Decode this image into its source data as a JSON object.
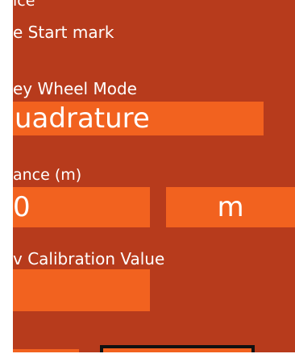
{
  "top_cut_text": "ice",
  "start_mark_text": "e Start mark",
  "wheel_mode_label": "ey Wheel Mode",
  "wheel_mode_value": "uadrature",
  "distance_label": "ance (m)",
  "distance_value": "0",
  "distance_unit": "m",
  "calibration_label": "v Calibration Value",
  "calibration_value": "",
  "colors": {
    "panel_bg": "#b73b1c",
    "field_bg": "#f2621f",
    "text": "#ffffff",
    "button_border": "#111111"
  }
}
